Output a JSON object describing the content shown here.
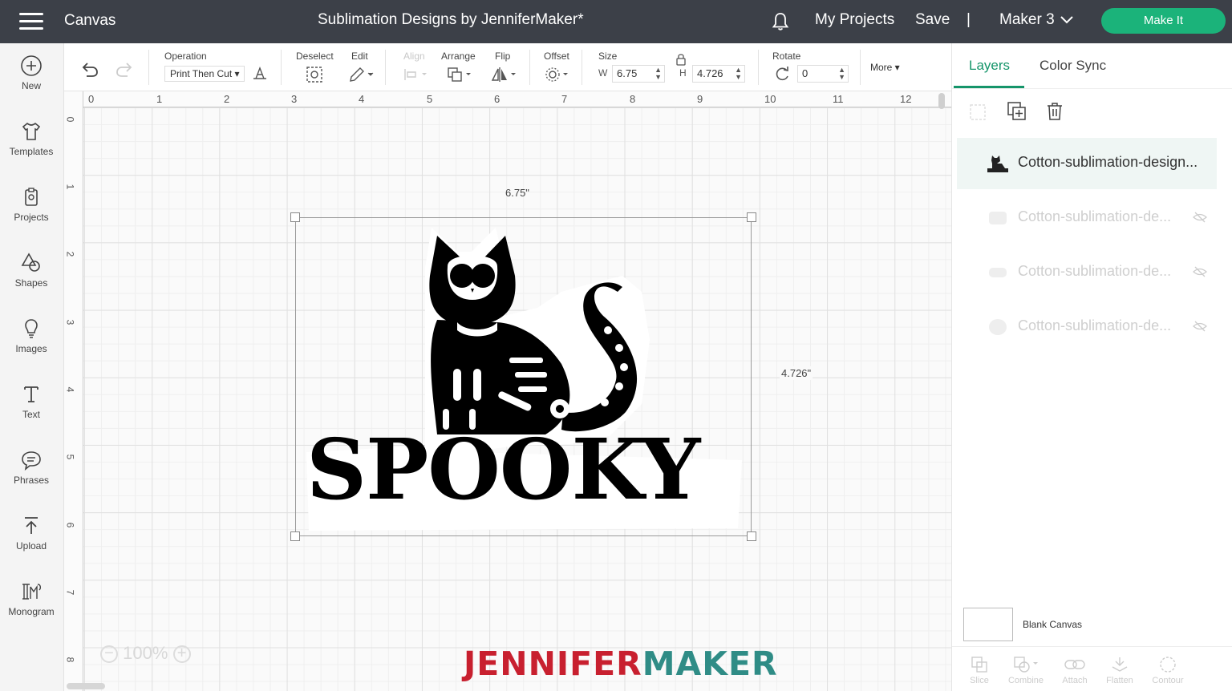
{
  "topbar": {
    "app_title": "Canvas",
    "doc_title": "Sublimation Designs by JenniferMaker*",
    "my_projects": "My Projects",
    "save": "Save",
    "separator": "|",
    "machine": "Maker 3",
    "make_it": "Make It"
  },
  "sidebar": {
    "items": [
      {
        "label": "New",
        "icon": "plus-circle-icon"
      },
      {
        "label": "Templates",
        "icon": "shirt-icon"
      },
      {
        "label": "Projects",
        "icon": "clipboard-icon"
      },
      {
        "label": "Shapes",
        "icon": "shapes-icon"
      },
      {
        "label": "Images",
        "icon": "lightbulb-icon"
      },
      {
        "label": "Text",
        "icon": "text-icon"
      },
      {
        "label": "Phrases",
        "icon": "speech-bubble-icon"
      },
      {
        "label": "Upload",
        "icon": "upload-icon"
      },
      {
        "label": "Monogram",
        "icon": "monogram-icon"
      }
    ]
  },
  "toolbar": {
    "operation_label": "Operation",
    "operation_value": "Print Then Cut",
    "deselect_label": "Deselect",
    "edit_label": "Edit",
    "align_label": "Align",
    "arrange_label": "Arrange",
    "flip_label": "Flip",
    "offset_label": "Offset",
    "size_label": "Size",
    "w_label": "W",
    "w_value": "6.75",
    "h_label": "H",
    "h_value": "4.726",
    "rotate_label": "Rotate",
    "rotate_value": "0",
    "more_label": "More"
  },
  "canvas": {
    "ruler_top": [
      "0",
      "1",
      "2",
      "3",
      "4",
      "5",
      "6",
      "7",
      "8",
      "9",
      "10",
      "11",
      "12"
    ],
    "ruler_left": [
      "0",
      "1",
      "2",
      "3",
      "4",
      "5",
      "6",
      "7",
      "8"
    ],
    "width_dim": "6.75\"",
    "height_dim": "4.726\"",
    "zoom": "100%",
    "design_text": "SPOOKY",
    "brand_part1": "JENNIFER",
    "brand_part2": "MAKER",
    "brand_color1": "#c8202f",
    "brand_color2": "#2f8c86"
  },
  "panel": {
    "tabs": [
      "Layers",
      "Color Sync"
    ],
    "active_tab": "Layers",
    "layers": [
      {
        "name": "Cotton-sublimation-design...",
        "selected": true,
        "hidden": false
      },
      {
        "name": "Cotton-sublimation-de...",
        "selected": false,
        "hidden": true
      },
      {
        "name": "Cotton-sublimation-de...",
        "selected": false,
        "hidden": true
      },
      {
        "name": "Cotton-sublimation-de...",
        "selected": false,
        "hidden": true
      }
    ],
    "blank_canvas": "Blank Canvas",
    "bottom_tools": [
      "Slice",
      "Combine",
      "Attach",
      "Flatten",
      "Contour"
    ]
  },
  "colors": {
    "topbar_bg": "#3c4048",
    "accent_green": "#1bb37a"
  }
}
